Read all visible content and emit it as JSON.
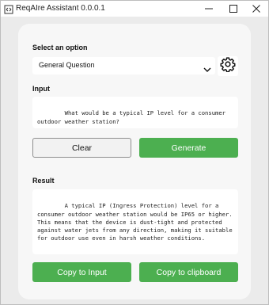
{
  "window": {
    "title": "ReqAIre Assistant 0.0.0.1",
    "controls": {
      "minimize": "minimize-icon",
      "maximize": "maximize-icon",
      "close": "close-icon"
    }
  },
  "select_section": {
    "label": "Select an option",
    "selected_value": "General Question",
    "settings_icon": "gear-icon"
  },
  "input_section": {
    "label": "Input",
    "value": "What would be a typical IP level for a consumer outdoor weather station?"
  },
  "actions": {
    "clear_label": "Clear",
    "generate_label": "Generate"
  },
  "result_section": {
    "label": "Result",
    "value": "A typical IP (Ingress Protection) level for a consumer outdoor weather station would be IP65 or higher. This means that the device is dust-tight and protected against water jets from any direction, making it suitable for outdoor use even in harsh weather conditions."
  },
  "footer": {
    "copy_to_input_label": "Copy to Input",
    "copy_to_clipboard_label": "Copy to clipboard"
  },
  "colors": {
    "accent_green": "#4caf50",
    "card_background": "#f7f7f7",
    "window_background": "#ebebeb"
  }
}
